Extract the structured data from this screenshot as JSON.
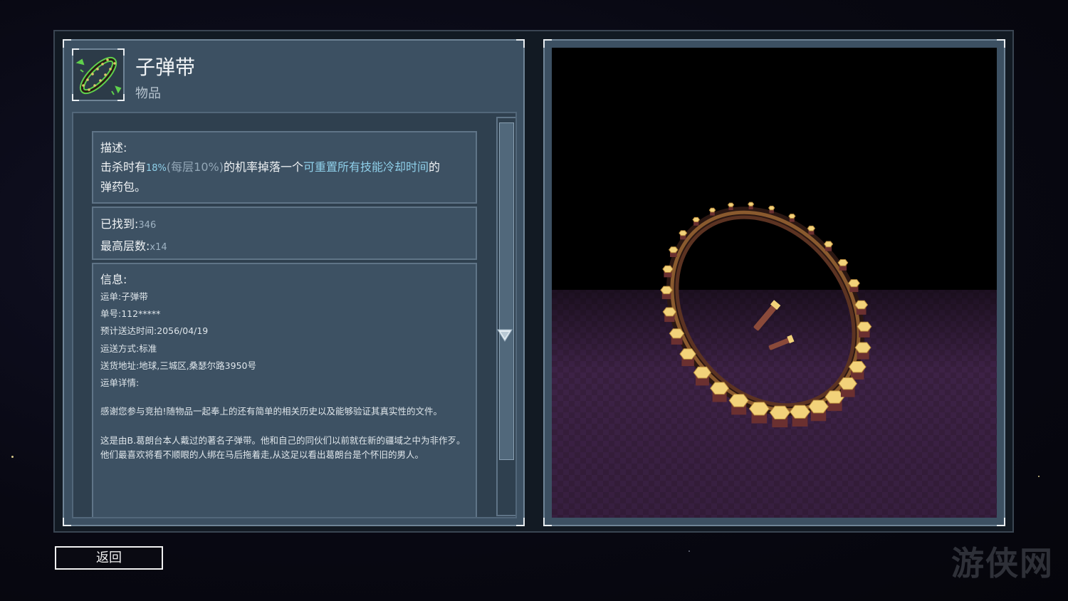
{
  "item": {
    "title": "子弹带",
    "category": "物品"
  },
  "description": {
    "heading": "描述:",
    "prefix": "击杀时有",
    "chance": "18%",
    "per_stack": "(每层10%)",
    "middle": "的机率掉落一个",
    "effect": "可重置所有技能冷却时间",
    "suffix": "的",
    "line2": "弹药包。"
  },
  "stats": {
    "found_label": "已找到:",
    "found_value": "346",
    "max_stack_label": "最高层数:",
    "max_stack_value": "x14"
  },
  "info": {
    "heading": "信息:",
    "lines": [
      {
        "label": "运单:",
        "value": "子弹带"
      },
      {
        "label": "单号:",
        "value": "112*****"
      },
      {
        "label": "预计送达时间:",
        "value": "2056/04/19"
      },
      {
        "label": "运送方式:",
        "value": "标准"
      },
      {
        "label": "送货地址:",
        "value": "地球,三城区,桑瑟尔路3950号"
      },
      {
        "label": "运单详情:",
        "value": ""
      }
    ],
    "paragraph1": "感谢您参与竞拍!随物品一起奉上的还有简单的相关历史以及能够验证其真实性的文件。",
    "paragraph2": "这是由B.葛朗台本人戴过的著名子弹带。他和自己的同伙们以前就在新的疆域之中为非作歹。他们最喜欢将看不顺眼的人绑在马后拖着走,从这足以看出葛朗台是个怀旧的男人。"
  },
  "back_button": "返回",
  "watermark": "游侠网",
  "colors": {
    "panel": "#3c5062",
    "card": "#3d5163",
    "accent_text": "#8fd0ea",
    "floor": "#3a1f3f",
    "belt": "#5c3322",
    "bullet_tip": "#f2d27a"
  },
  "icons": {
    "item_icon": "ammo-belt-icon",
    "scroll_arrow": "triangle-down-icon"
  }
}
